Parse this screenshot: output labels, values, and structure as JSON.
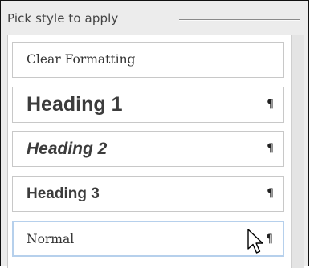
{
  "panel": {
    "title": "Pick style to apply"
  },
  "styles": [
    {
      "label": "Clear Formatting",
      "mark": ""
    },
    {
      "label": "Heading 1",
      "mark": "¶"
    },
    {
      "label": "Heading 2",
      "mark": "¶"
    },
    {
      "label": "Heading 3",
      "mark": "¶"
    },
    {
      "label": "Normal",
      "mark": "¶"
    }
  ],
  "hovered_item": "Normal",
  "colors": {
    "panel_background": "#ececec",
    "item_border": "#c8c8c8",
    "hover_border": "#b6d0ec"
  },
  "icons": {
    "paragraph_mark": "pilcrow-icon",
    "pointer": "mouse-cursor-icon"
  }
}
